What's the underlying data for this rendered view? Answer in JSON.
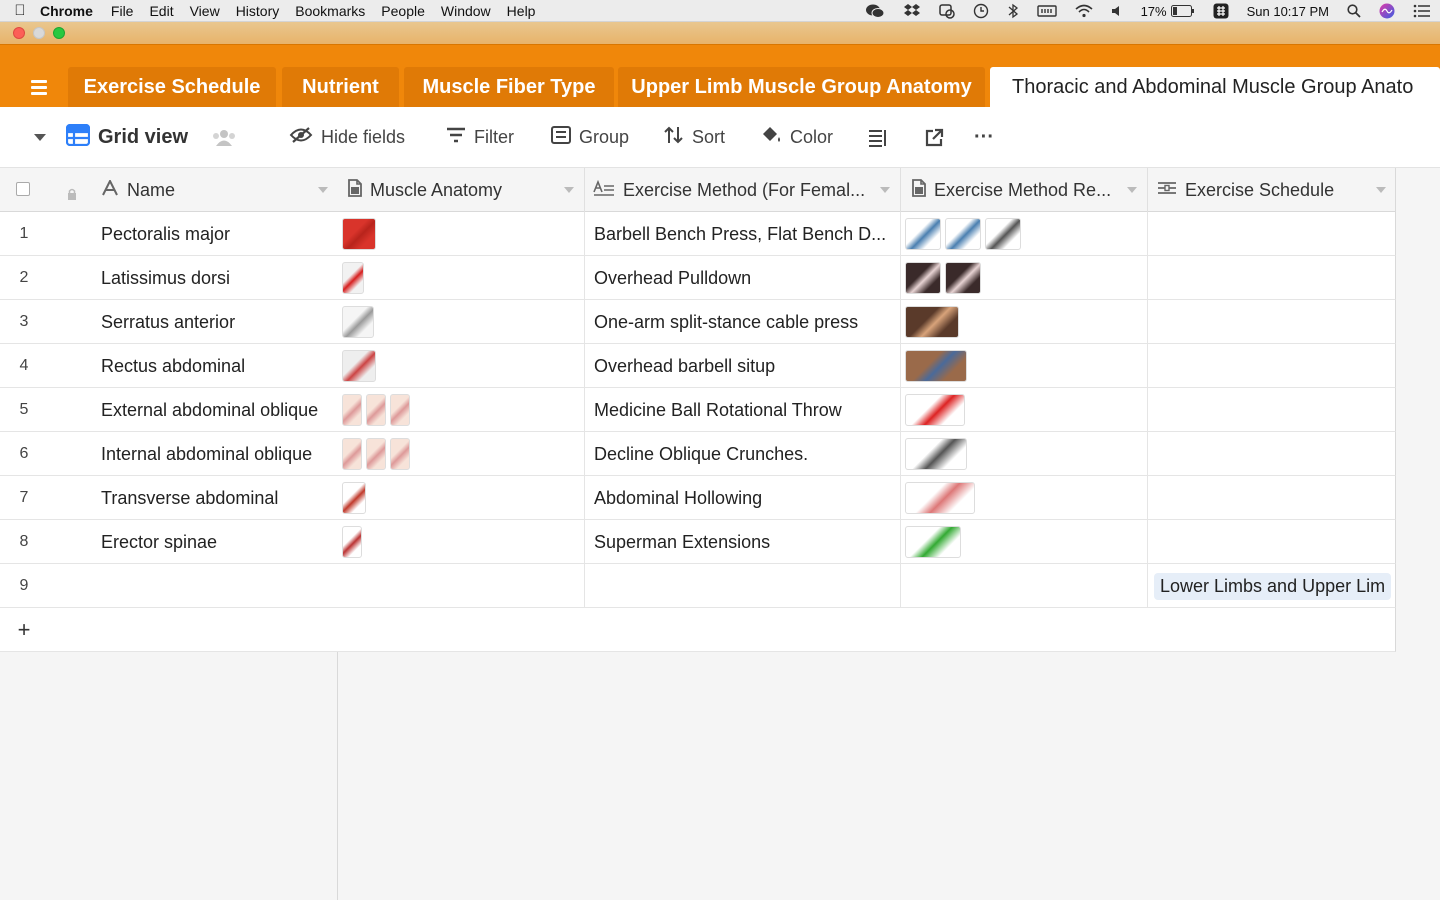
{
  "menubar": {
    "app": "Chrome",
    "items": [
      "File",
      "Edit",
      "View",
      "History",
      "Bookmarks",
      "People",
      "Window",
      "Help"
    ],
    "battery": "17%",
    "clock": "Sun 10:17 PM"
  },
  "tabs": [
    {
      "label": "Exercise Schedule"
    },
    {
      "label": "Nutrient"
    },
    {
      "label": "Muscle Fiber Type"
    },
    {
      "label": "Upper Limb Muscle Group Anatomy"
    },
    {
      "label": "Thoracic and Abdominal Muscle Group Anato"
    }
  ],
  "toolbar": {
    "view_name": "Grid view",
    "hide_fields": "Hide fields",
    "filter": "Filter",
    "group": "Group",
    "sort": "Sort",
    "color": "Color",
    "more": "···"
  },
  "columns": {
    "name": "Name",
    "muscle_anatomy": "Muscle Anatomy",
    "method_female": "Exercise Method (For Femal...",
    "method_ref": "Exercise Method Re...",
    "schedule": "Exercise Schedule"
  },
  "rows": [
    {
      "num": "1",
      "name": "Pectoralis major",
      "method": "Barbell Bench Press, Flat Bench D...",
      "schedule": ""
    },
    {
      "num": "2",
      "name": "Latissimus dorsi",
      "method": "Overhead Pulldown",
      "schedule": ""
    },
    {
      "num": "3",
      "name": "Serratus anterior",
      "method": "One-arm split-stance cable press",
      "schedule": ""
    },
    {
      "num": "4",
      "name": "Rectus abdominal",
      "method": "Overhead barbell situp",
      "schedule": ""
    },
    {
      "num": "5",
      "name": "External abdominal oblique",
      "method": "Medicine Ball Rotational Throw",
      "schedule": ""
    },
    {
      "num": "6",
      "name": "Internal abdominal oblique",
      "method": "Decline Oblique Crunches.",
      "schedule": ""
    },
    {
      "num": "7",
      "name": "Transverse abdominal",
      "method": "Abdominal Hollowing",
      "schedule": ""
    },
    {
      "num": "8",
      "name": "Erector spinae",
      "method": "Superman Extensions",
      "schedule": ""
    },
    {
      "num": "9",
      "name": "",
      "method": "",
      "schedule": "Lower Limbs and Upper Lim"
    }
  ],
  "add_row": "+",
  "colors": {
    "accent_orange": "#f0870a",
    "tab_orange": "#e07a06",
    "grid_icon_blue": "#2d7ff9"
  }
}
